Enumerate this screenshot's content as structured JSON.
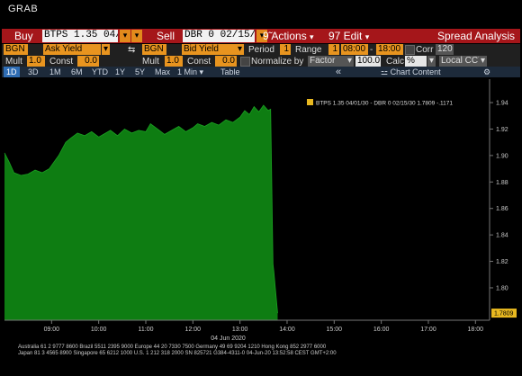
{
  "window": {
    "title": "GRAB"
  },
  "toolbar": {
    "buy_label": "Buy",
    "buy_security": "BTPS 1.35 04/",
    "sell_label": "Sell",
    "sell_security": "DBR 0 02/15/",
    "actions_label": "9̃ Actions",
    "edit_label": "97 Edit",
    "title": "Spread Analysis"
  },
  "settings": {
    "source1": "BGN",
    "field1": "Ask Yield",
    "source2": "BGN",
    "field2": "Bid Yield",
    "period_label": "Period",
    "period_value": "1",
    "range_label": "Range",
    "range_value": "1",
    "start_time": "08:00",
    "end_time": "18:00",
    "corr_label": "Corr",
    "corr_value": "120",
    "mult_label": "Mult",
    "mult1": "1.0",
    "const_label": "Const",
    "const1": "0.0",
    "mult2": "1.0",
    "const2": "0.0",
    "normalize_label": "Normalize by",
    "normalize_value": "Factor",
    "factor_value": "100.0",
    "calc_label": "Calc",
    "calc_value": "%",
    "currency_value": "Local CCY"
  },
  "tabs": [
    "1D",
    "3D",
    "1M",
    "6M",
    "YTD",
    "1Y",
    "5Y",
    "Max"
  ],
  "interval": "1 Min",
  "table_label": "Table",
  "collapse_icon": "double-chevron-left-icon",
  "chart_content_label": "Chart Content",
  "footer": {
    "line1": "Australia 61 2 9777 8600  Brazil 5511 2395 9000  Europe 44 20 7330 7500  Germany 49 69 9204 1210  Hong Kong 852 2977 6000",
    "line2": "Japan 81 3 4565 8900        Singapore 65 6212 1000        U.S. 1 212 318 2000        SN 825721 G384-4311-0 04-Jun-20 13:52:58 CEST GMT+2:00"
  },
  "colors": {
    "accent": "#a5161a",
    "series": "#0e7d12",
    "button": "#e8941f"
  },
  "chart_data": {
    "type": "area",
    "legend": "BTPS 1.35 04/01/30 - DBR 0 02/15/30  1.7809  -.1171",
    "last_value_label": "1.7809",
    "date_label": "04 Jun 2020",
    "x_ticks": [
      "09:00",
      "10:00",
      "11:00",
      "12:00",
      "13:00",
      "14:00",
      "15:00",
      "16:00",
      "17:00",
      "18:00"
    ],
    "y_ticks": [
      "1.94",
      "1.92",
      "1.90",
      "1.88",
      "1.86",
      "1.84",
      "1.82",
      "1.80"
    ],
    "ylim": [
      1.7755,
      1.955
    ],
    "xlim": [
      8.0,
      18.3
    ],
    "x": [
      8.0,
      8.1,
      8.2,
      8.35,
      8.5,
      8.65,
      8.8,
      8.95,
      9.05,
      9.15,
      9.3,
      9.4,
      9.55,
      9.7,
      9.85,
      10.0,
      10.1,
      10.25,
      10.4,
      10.55,
      10.7,
      10.85,
      11.0,
      11.1,
      11.25,
      11.4,
      11.55,
      11.7,
      11.85,
      12.0,
      12.1,
      12.25,
      12.4,
      12.55,
      12.7,
      12.85,
      13.0,
      13.1,
      13.2,
      13.3,
      13.4,
      13.5,
      13.6,
      13.65,
      13.7,
      13.72,
      13.75,
      13.8
    ],
    "values": [
      1.902,
      1.895,
      1.887,
      1.885,
      1.886,
      1.889,
      1.887,
      1.89,
      1.895,
      1.9,
      1.91,
      1.913,
      1.917,
      1.915,
      1.918,
      1.914,
      1.916,
      1.919,
      1.915,
      1.92,
      1.917,
      1.919,
      1.918,
      1.924,
      1.92,
      1.916,
      1.919,
      1.922,
      1.918,
      1.921,
      1.924,
      1.922,
      1.925,
      1.923,
      1.927,
      1.925,
      1.929,
      1.934,
      1.931,
      1.937,
      1.933,
      1.938,
      1.934,
      1.935,
      1.818,
      1.812,
      1.8,
      1.7809
    ],
    "grid": false,
    "legend_position": "top-right"
  }
}
